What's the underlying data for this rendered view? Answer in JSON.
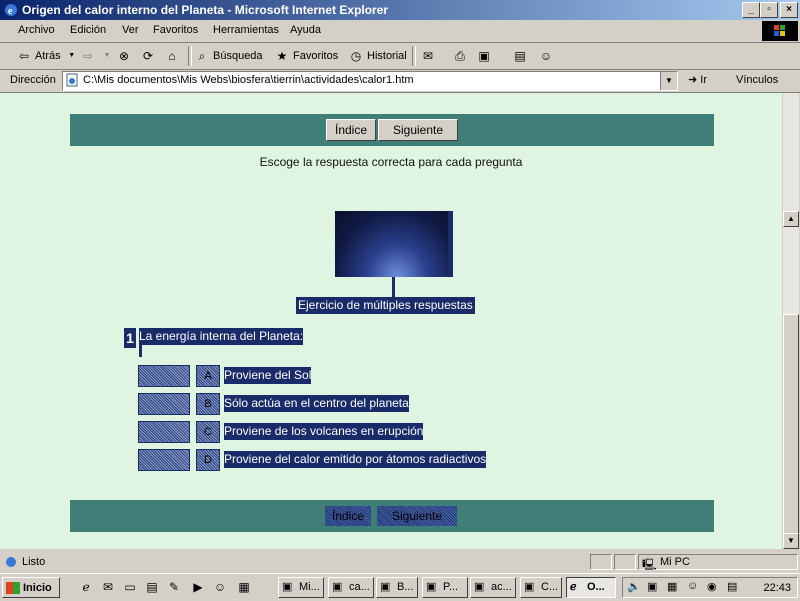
{
  "window": {
    "title": "Origen del calor interno del Planeta - Microsoft Internet Explorer",
    "controls": {
      "minimize": "_",
      "maximize": "▫",
      "close": "×"
    }
  },
  "menu": {
    "items": [
      "Archivo",
      "Edición",
      "Ver",
      "Favoritos",
      "Herramientas",
      "Ayuda"
    ]
  },
  "toolbar": {
    "back": "Atrás",
    "search": "Búsqueda",
    "favorites": "Favoritos",
    "history": "Historial"
  },
  "address": {
    "label": "Dirección",
    "url": "C:\\Mis documentos\\Mis Webs\\biosfera\\tierrin\\actividades\\calor1.htm",
    "go": "Ir",
    "links": "Vínculos"
  },
  "page": {
    "nav": {
      "index": "Índice",
      "next": "Siguiente"
    },
    "instruction": "Escoge la respuesta correcta para cada pregunta",
    "exercise_label": "Ejercicio de múltiples respuestas",
    "question": {
      "number": "1",
      "text": "La energía interna del Planeta:",
      "answers": [
        {
          "letter": "A",
          "text": "Proviene del Sol"
        },
        {
          "letter": "B",
          "text": "Sólo actúa en el centro del planeta"
        },
        {
          "letter": "C",
          "text": "Proviene de los volcanes en erupción"
        },
        {
          "letter": "D",
          "text": "Proviene del calor emitido por átomos radiactivos"
        }
      ]
    },
    "bottom_nav": {
      "index": "Índice",
      "next": "Siguiente"
    }
  },
  "status": {
    "text": "Listo",
    "zone": "Mi PC"
  },
  "taskbar": {
    "start": "Inicio",
    "tasks": [
      "Mi...",
      "ca...",
      "B...",
      "P...",
      "ac...",
      "C...",
      "O..."
    ],
    "clock": "22:43"
  },
  "colors": {
    "page_bg": "#dff5e1",
    "band": "#3f7f78",
    "dark_label": "#1a2b6a"
  }
}
